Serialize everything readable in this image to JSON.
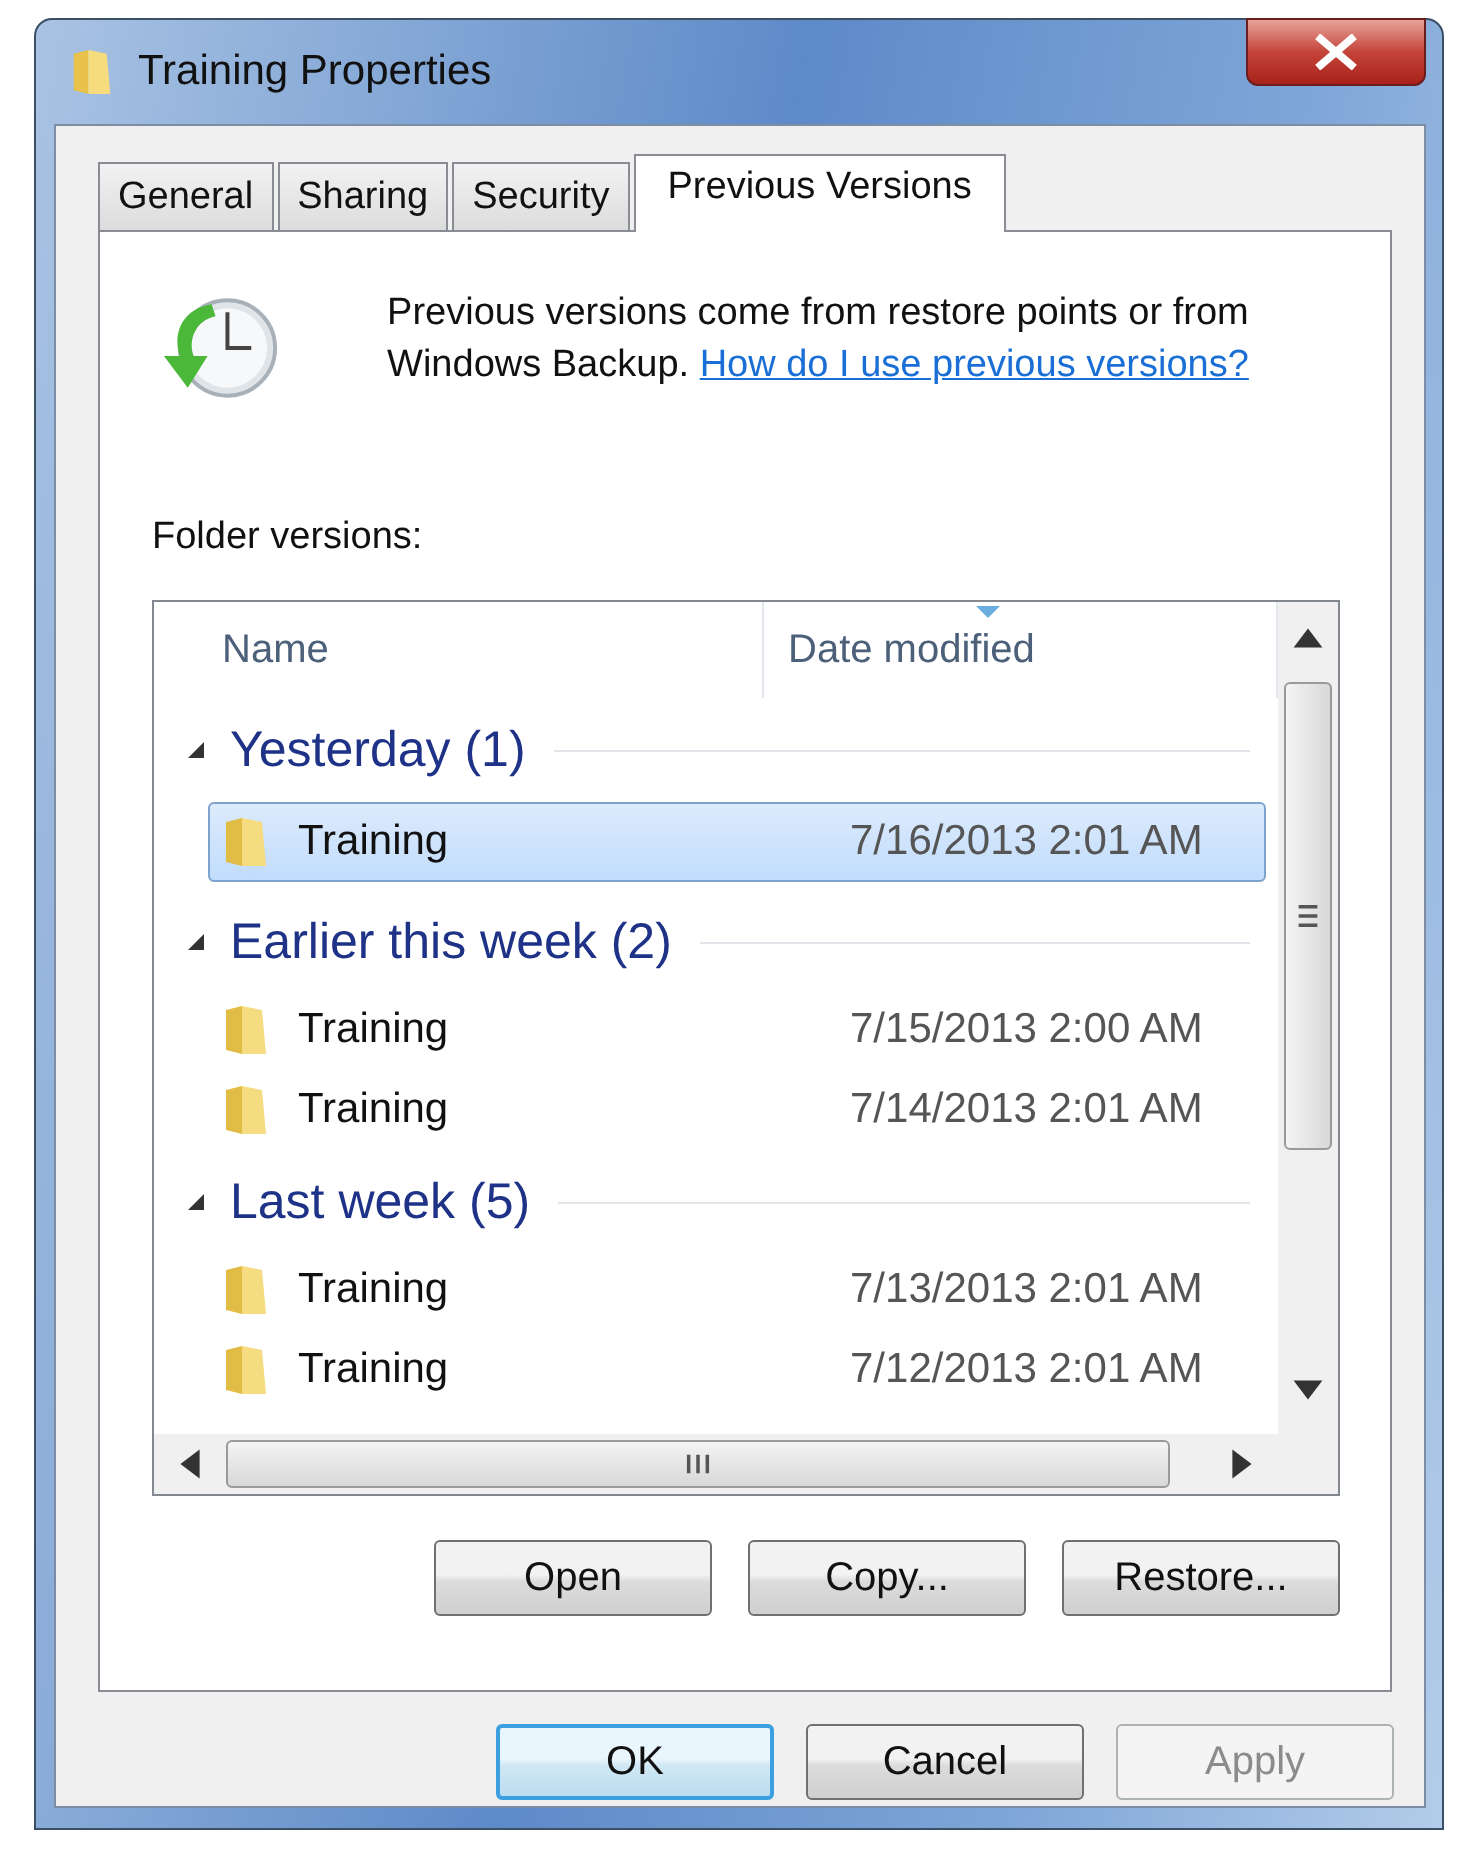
{
  "window": {
    "title": "Training Properties"
  },
  "tabs": [
    {
      "label": "General",
      "selected": false
    },
    {
      "label": "Sharing",
      "selected": false
    },
    {
      "label": "Security",
      "selected": false
    },
    {
      "label": "Previous Versions",
      "selected": true
    }
  ],
  "description": {
    "text": "Previous versions come from restore points or from Windows Backup.",
    "link": "How do I use previous versions?"
  },
  "list_label": "Folder versions:",
  "columns": [
    {
      "label": "Name",
      "sorted": false
    },
    {
      "label": "Date modified",
      "sorted": true
    }
  ],
  "groups": [
    {
      "title": "Yesterday (1)",
      "expanded": true,
      "items": [
        {
          "name": "Training",
          "date": "7/16/2013 2:01 AM",
          "selected": true
        }
      ]
    },
    {
      "title": "Earlier this week (2)",
      "expanded": true,
      "items": [
        {
          "name": "Training",
          "date": "7/15/2013 2:00 AM",
          "selected": false
        },
        {
          "name": "Training",
          "date": "7/14/2013 2:01 AM",
          "selected": false
        }
      ]
    },
    {
      "title": "Last week (5)",
      "expanded": true,
      "items": [
        {
          "name": "Training",
          "date": "7/13/2013 2:01 AM",
          "selected": false
        },
        {
          "name": "Training",
          "date": "7/12/2013 2:01 AM",
          "selected": false
        }
      ]
    }
  ],
  "action_buttons": [
    {
      "label": "Open",
      "disabled": false
    },
    {
      "label": "Copy...",
      "disabled": false
    },
    {
      "label": "Restore...",
      "disabled": false
    }
  ],
  "dialog_buttons": [
    {
      "label": "OK",
      "default": true,
      "disabled": false
    },
    {
      "label": "Cancel",
      "default": false,
      "disabled": false
    },
    {
      "label": "Apply",
      "default": false,
      "disabled": true
    }
  ]
}
